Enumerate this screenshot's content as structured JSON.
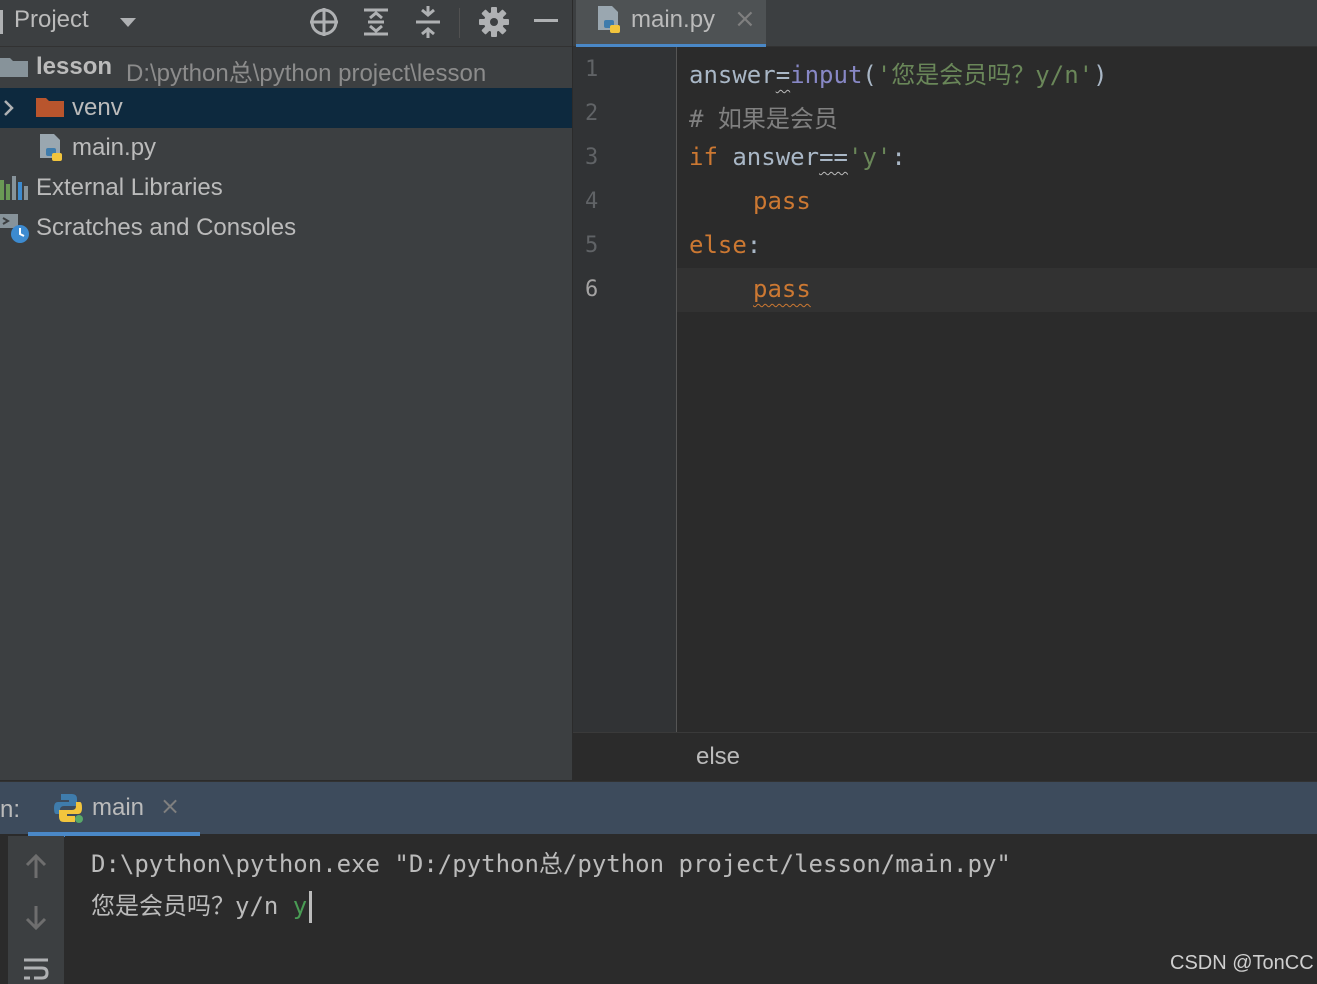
{
  "project_panel": {
    "title": "Project",
    "tree": [
      {
        "label": "lesson",
        "path": "D:\\python总\\python project\\lesson"
      },
      {
        "label": "venv"
      },
      {
        "label": "main.py"
      },
      {
        "label": "External Libraries"
      },
      {
        "label": "Scratches and Consoles"
      }
    ]
  },
  "editor": {
    "tab_label": "main.py",
    "line_numbers": [
      "1",
      "2",
      "3",
      "4",
      "5",
      "6"
    ],
    "current_line": 6,
    "code": {
      "l1_var": "answer",
      "l1_eq": "=",
      "l1_fn": "input",
      "l1_open": "(",
      "l1_str": "'您是会员吗？y/n'",
      "l1_close": ")",
      "l2_comment": "# 如果是会员",
      "l3_kw": "if",
      "l3_var": " answer",
      "l3_eq": "==",
      "l3_str": "'y'",
      "l3_colon": ":",
      "l4_kw": "pass",
      "l5_kw": "else",
      "l5_colon": ":",
      "l6_kw": "pass"
    },
    "breadcrumb": "else"
  },
  "run_panel": {
    "label": "n:",
    "tab_label": "main",
    "console_lines": {
      "command": "D:\\python\\python.exe \"D:/python总/python project/lesson/main.py\"",
      "prompt": "您是会员吗？y/n ",
      "user_input": "y"
    }
  },
  "watermark": "CSDN @TonCC",
  "colors": {
    "selection": "#0d293e",
    "keyword": "#cc7832",
    "builtin": "#8888c6",
    "string": "#6a8759",
    "comment": "#808080",
    "accent": "#4a88c7",
    "user_input": "#499c54"
  }
}
